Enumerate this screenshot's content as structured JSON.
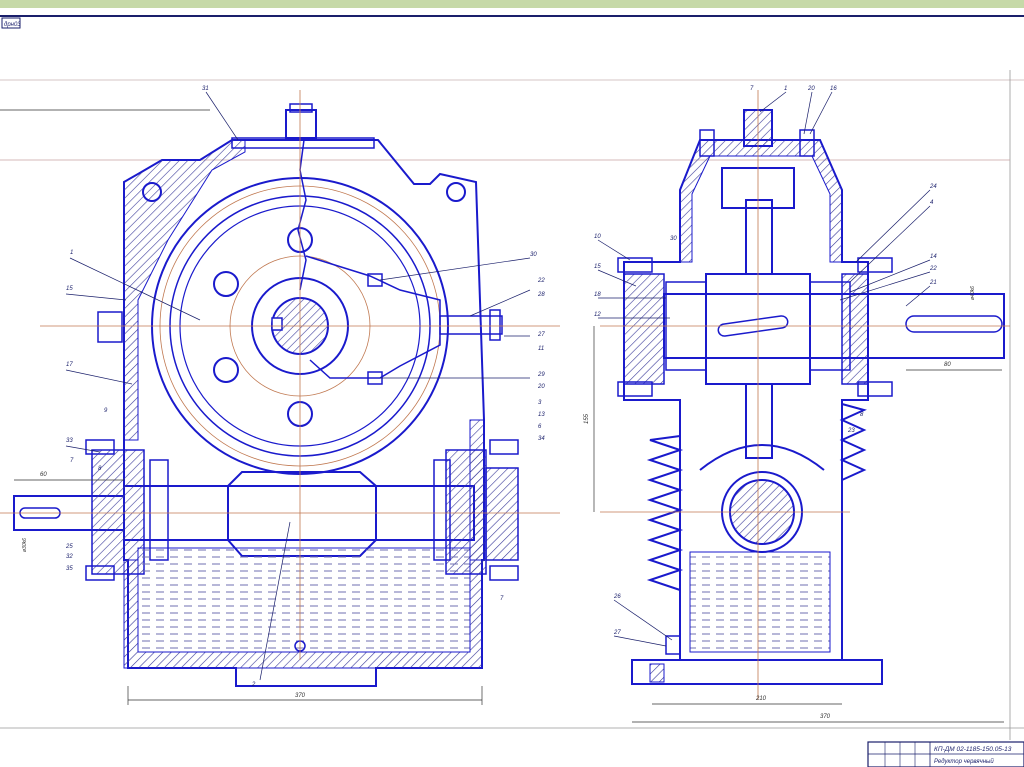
{
  "colors": {
    "top_band": "#c6d9a8",
    "frame": "#1a1f6b",
    "outline": "#1a1acc",
    "hatch": "#3a3a9a",
    "centerline": "#c07850",
    "dim": "#333333",
    "oil": "#6f6fb0"
  },
  "sheet": {
    "corner_tag": "дрн03"
  },
  "front_view": {
    "overall_width": "370",
    "input_shaft_length": "60",
    "input_diameter": "ø30k6",
    "labels": [
      "31",
      "1",
      "15",
      "17",
      "33",
      "7",
      "25",
      "32",
      "35",
      "30",
      "22",
      "28",
      "27",
      "11",
      "29",
      "20",
      "3",
      "13",
      "6",
      "34",
      "2",
      "8",
      "9",
      "7"
    ]
  },
  "side_view": {
    "labels": [
      "1",
      "20",
      "16",
      "10",
      "15",
      "18",
      "12",
      "24",
      "4",
      "14",
      "22",
      "21",
      "7",
      "8",
      "23",
      "30",
      "26",
      "27"
    ],
    "dim_center_distance": "155",
    "dim_base": "210",
    "dim_overall": "370",
    "dim_output_length": "80",
    "dim_output_diameter": "ø40k6"
  },
  "title_block": {
    "doc_code": "КП-ДМ 02-1185-150.05-13",
    "name": "Редуктор червячный"
  }
}
